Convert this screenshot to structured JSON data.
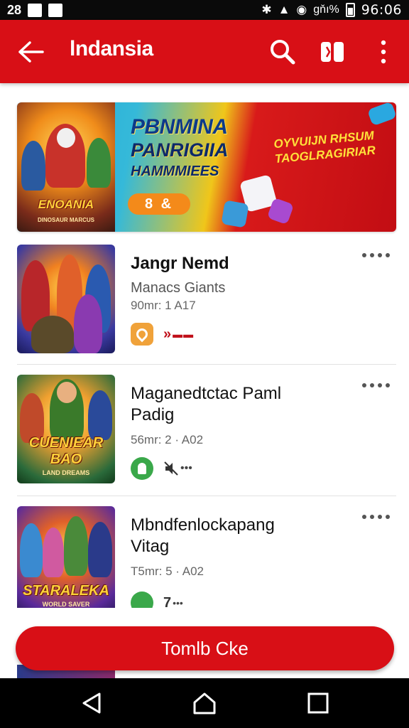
{
  "status_bar": {
    "left_icons": [
      "notification-icon",
      "image-icon",
      "mail-icon"
    ],
    "left_label": "28",
    "right_text": "ɡňı%",
    "time": "96:06"
  },
  "app_bar": {
    "title": "lndansia",
    "accent_color": "#d80f16"
  },
  "banner": {
    "art_title": "ENOANIA",
    "art_subtitle": "DINOSAUR MARCUS",
    "headline1": "PBNMINA",
    "headline2": "PANRIGIIA",
    "headline3": "HAMMMIEES",
    "pill_text": "8 &",
    "right_text": "OYVUIJN RHSUM TAOGLRAGIRIAR"
  },
  "games": [
    {
      "title": "Jangr Nemd",
      "subtitle": "Manacs Giants",
      "meta": "90mr:  1  A17",
      "icon_color": "#f0a23a",
      "action_icon": "arrow-icon",
      "action_text": "",
      "thumb_title": "",
      "thumb_sub": ""
    },
    {
      "title": "Maganedtctac Paml Padig",
      "subtitle": "",
      "meta": "56mr:  2 · A02",
      "icon_color": "#3aa84a",
      "action_icon": "mute-icon",
      "action_text": "",
      "thumb_title": "CUENIEAR BAO",
      "thumb_sub": "LAND DREAMS"
    },
    {
      "title": "Mbndfenlockapang Vitag",
      "subtitle": "",
      "meta": "T5mr:  5 · A02",
      "icon_color": "#3aa84a",
      "action_icon": "edit-icon",
      "action_text": "7",
      "thumb_title": "STARALEKA",
      "thumb_sub": "WORLD SAVER"
    }
  ],
  "cta": {
    "label": "Tomlb Cke"
  },
  "nav_bar": {
    "icons": [
      "back-triangle-icon",
      "home-icon",
      "recents-icon"
    ]
  }
}
